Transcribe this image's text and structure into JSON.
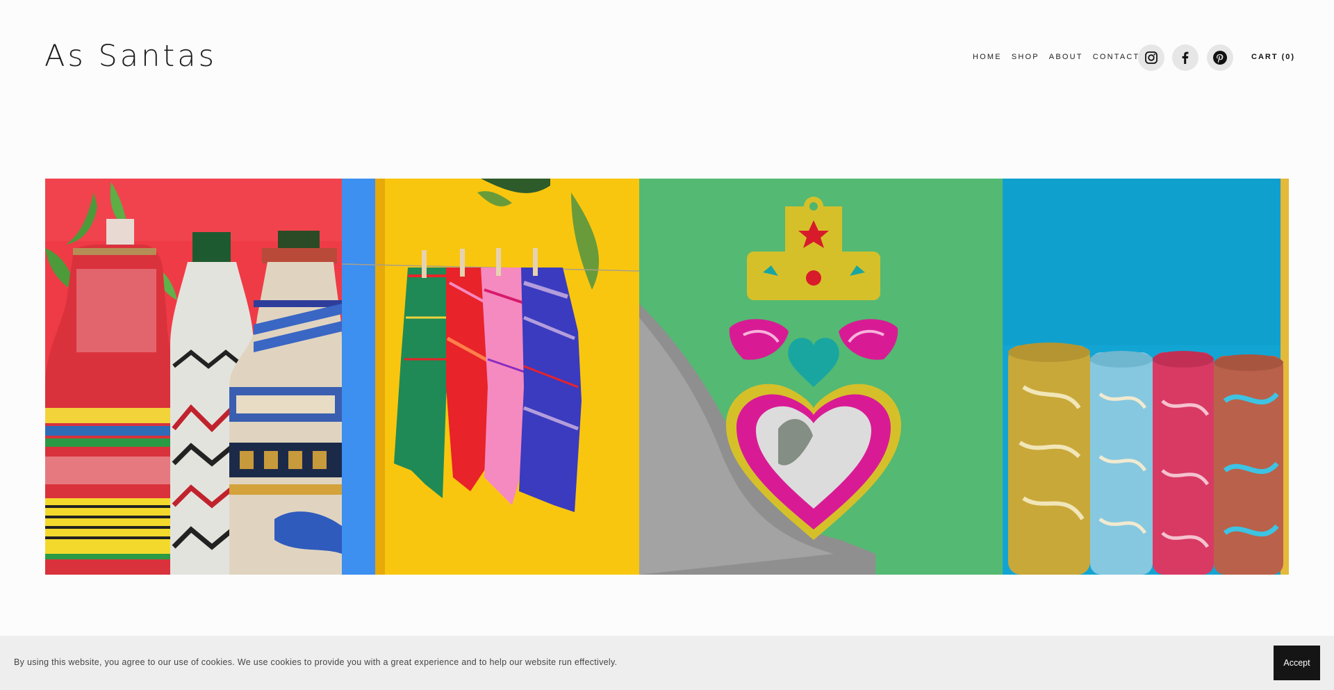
{
  "header": {
    "site_title": "As Santas",
    "nav": [
      {
        "label": "HOME"
      },
      {
        "label": "SHOP"
      },
      {
        "label": "ABOUT"
      },
      {
        "label": "CONTACT"
      }
    ],
    "social": [
      {
        "icon": "instagram-icon"
      },
      {
        "icon": "facebook-icon"
      },
      {
        "icon": "pinterest-icon"
      }
    ],
    "cart_label": "CART (0)"
  },
  "gallery": {
    "panels": [
      {
        "subject": "woven-bottles",
        "colors": [
          "#ef3b46",
          "#c8232f",
          "#f2d33a",
          "#2f6bb7"
        ]
      },
      {
        "subject": "hanging-napkins",
        "colors": [
          "#f9c60f",
          "#3d8ff0",
          "#e8232a",
          "#f58ac0",
          "#2a35b8"
        ]
      },
      {
        "subject": "tin-heart-mirror",
        "colors": [
          "#4fb46e",
          "#d6c02a",
          "#d81b95",
          "#1aa6a0"
        ]
      },
      {
        "subject": "rolled-mats",
        "colors": [
          "#12a5d4",
          "#c9a83a",
          "#86c8e0",
          "#d83a64"
        ]
      }
    ]
  },
  "cookie_banner": {
    "message": "By using this website, you agree to our use of cookies. We use cookies to provide you with a great experience and to help our website run effectively.",
    "accept_label": "Accept"
  }
}
